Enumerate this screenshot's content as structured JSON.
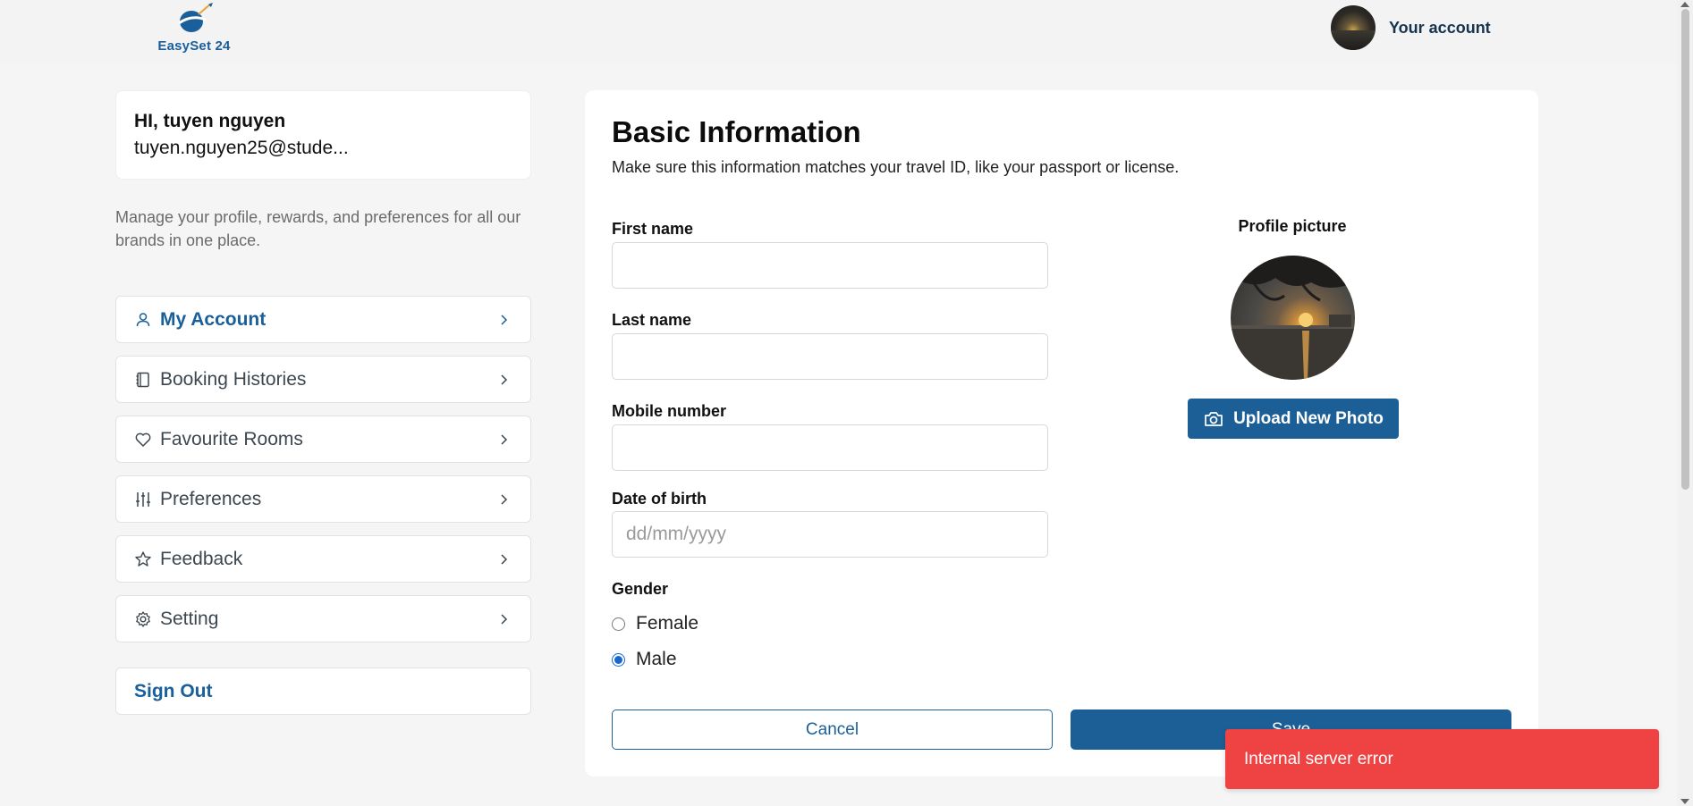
{
  "header": {
    "logo_text": "EasySet 24",
    "account_label": "Your account"
  },
  "sidebar": {
    "greeting": "HI, tuyen nguyen",
    "email": "tuyen.nguyen25@stude...",
    "description": "Manage your profile, rewards, and preferences for all our brands in one place.",
    "items": [
      {
        "label": "My Account",
        "icon": "user-icon",
        "active": true
      },
      {
        "label": "Booking Histories",
        "icon": "notebook-icon",
        "active": false
      },
      {
        "label": "Favourite Rooms",
        "icon": "heart-icon",
        "active": false
      },
      {
        "label": "Preferences",
        "icon": "sliders-icon",
        "active": false
      },
      {
        "label": "Feedback",
        "icon": "star-icon",
        "active": false
      },
      {
        "label": "Setting",
        "icon": "gear-icon",
        "active": false
      }
    ],
    "sign_out": "Sign Out"
  },
  "main": {
    "title": "Basic Information",
    "subtitle": "Make sure this information matches your travel ID, like your passport or license.",
    "fields": {
      "first_name": {
        "label": "First name",
        "value": "",
        "placeholder": ""
      },
      "last_name": {
        "label": "Last name",
        "value": "",
        "placeholder": ""
      },
      "mobile": {
        "label": "Mobile number",
        "value": "",
        "placeholder": ""
      },
      "dob": {
        "label": "Date of birth",
        "value": "",
        "placeholder": "dd/mm/yyyy"
      }
    },
    "gender": {
      "label": "Gender",
      "options": [
        "Female",
        "Male"
      ],
      "selected": "Male"
    },
    "profile_picture_label": "Profile picture",
    "upload_label": "Upload New Photo",
    "cancel_label": "Cancel",
    "save_label": "Save"
  },
  "toast": {
    "message": "Internal server error",
    "color": "#ef4343"
  },
  "colors": {
    "brand": "#1c5f96",
    "background": "#f5f5f5"
  }
}
